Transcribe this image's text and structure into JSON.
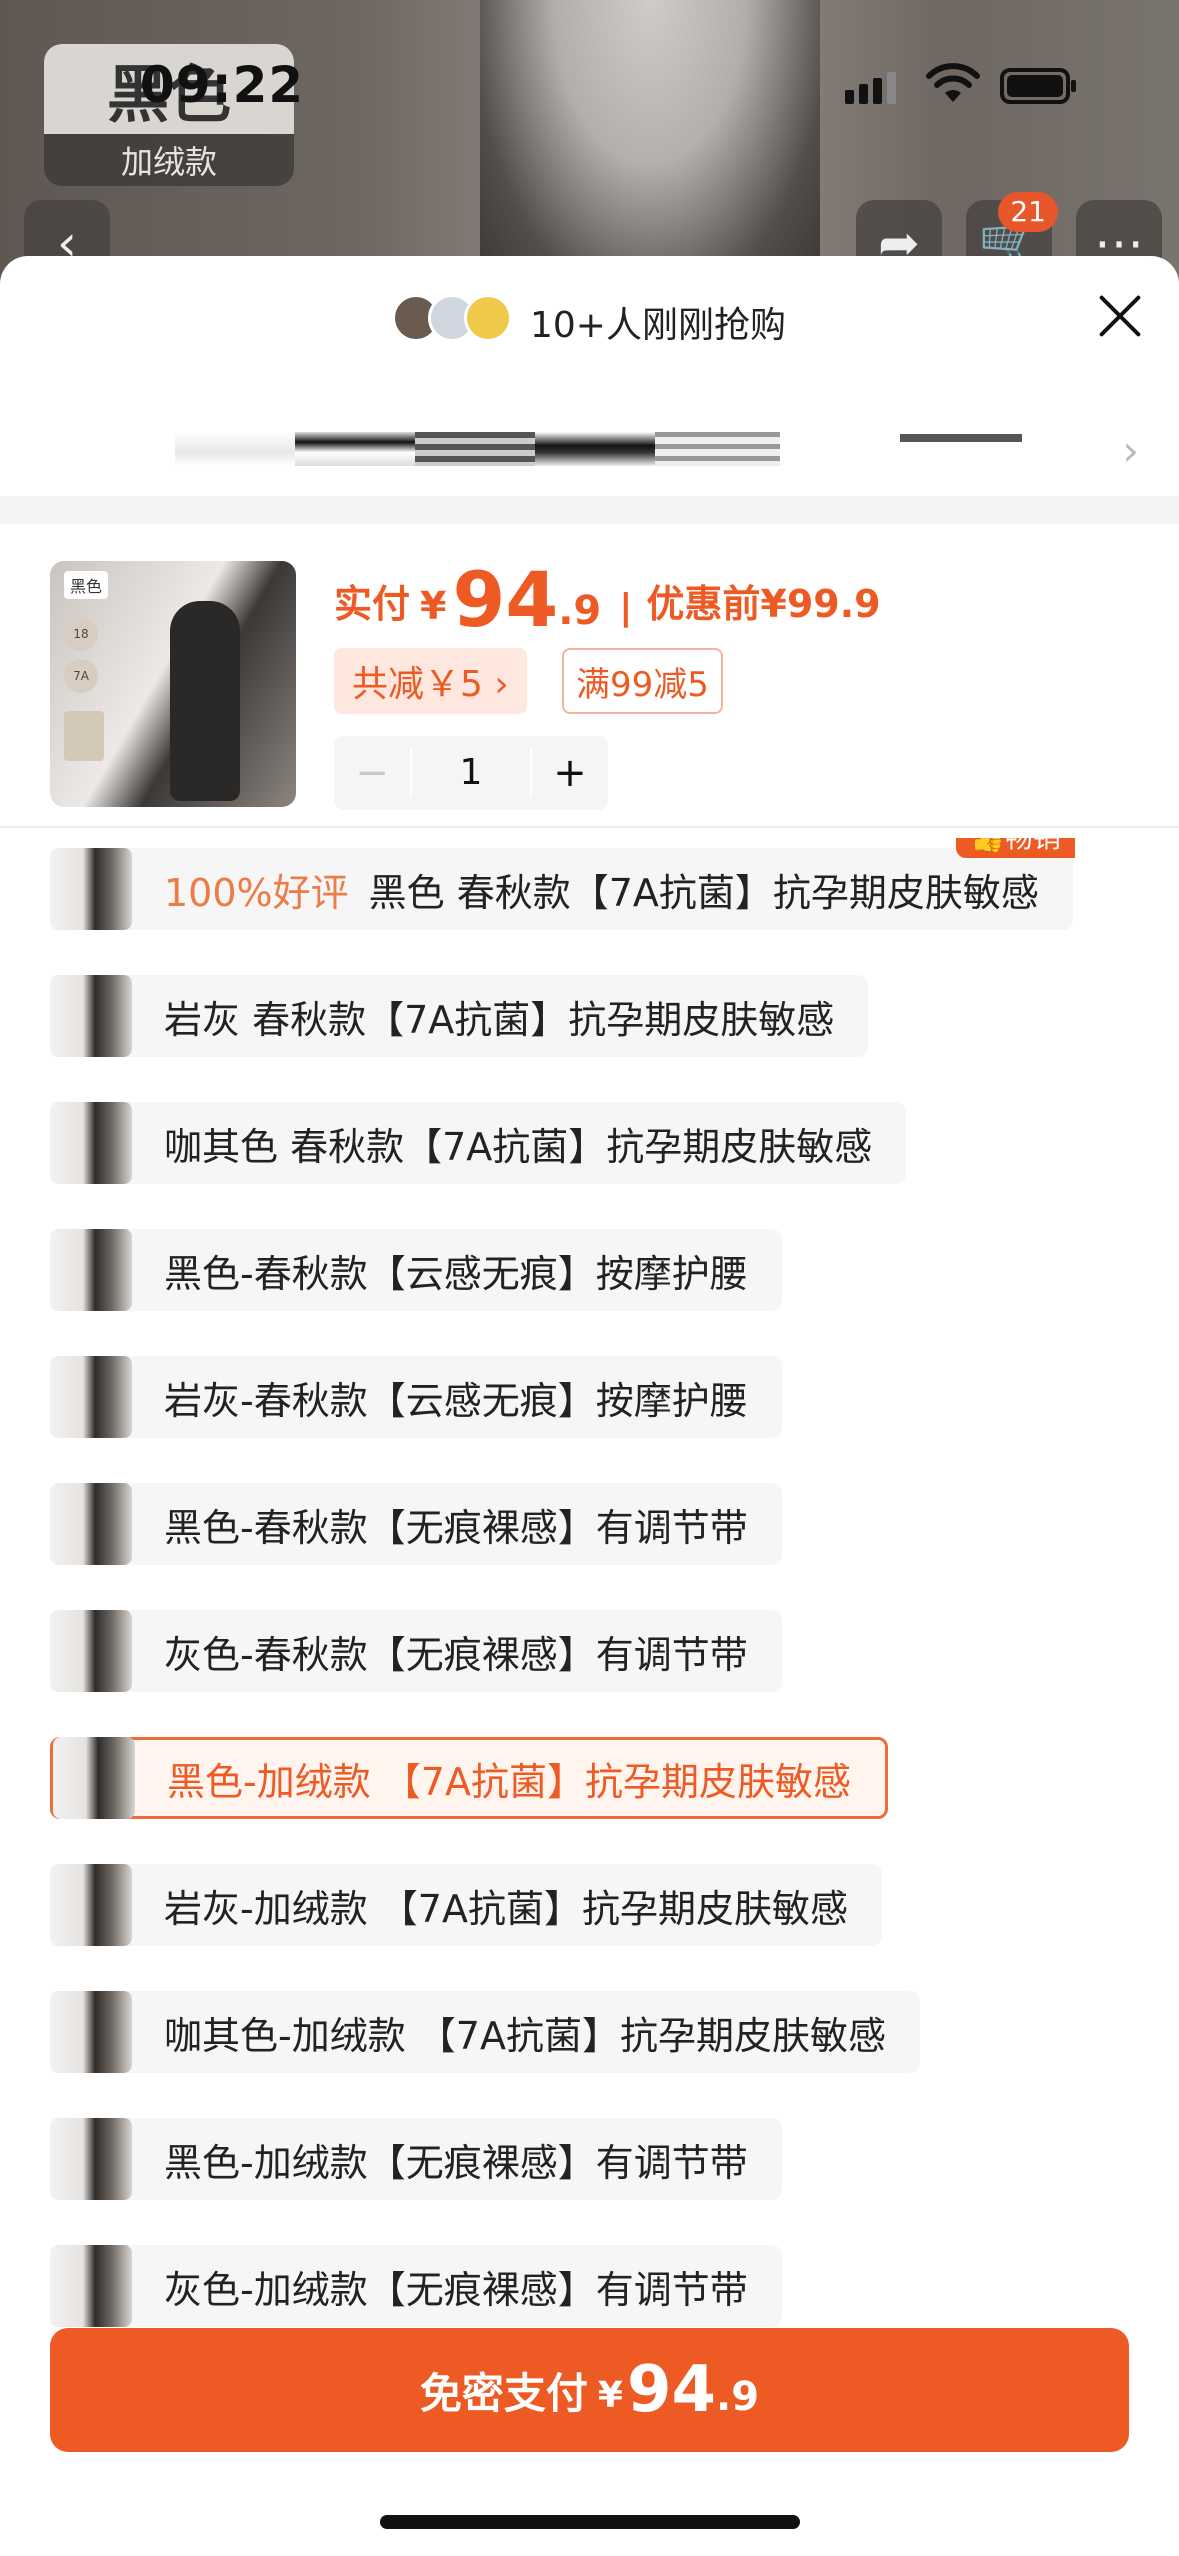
{
  "status_bar": {
    "time": "09:22"
  },
  "background": {
    "variant_tag_color": "黑色",
    "variant_tag_sub": "加绒款",
    "cart_count": "21"
  },
  "sheet": {
    "buyers_text": "10+人刚刚抢购",
    "product": {
      "image_label": "黑色",
      "price_prefix": "实付",
      "currency": "¥",
      "price_int": "94",
      "price_dec": ".9",
      "separator": "|",
      "original_price": "优惠前¥99.9",
      "discount": "共减￥5 ›",
      "coupon": "满99减5",
      "quantity": "1",
      "minus": "−",
      "plus": "+"
    },
    "options": [
      {
        "good_rating": "100%好评",
        "label": "黑色 春秋款【7A抗菌】抗孕期皮肤敏感",
        "badge": "畅销"
      },
      {
        "label": "岩灰 春秋款【7A抗菌】抗孕期皮肤敏感"
      },
      {
        "label": "咖其色 春秋款【7A抗菌】抗孕期皮肤敏感"
      },
      {
        "label": "黑色-春秋款【云感无痕】按摩护腰"
      },
      {
        "label": "岩灰-春秋款【云感无痕】按摩护腰"
      },
      {
        "label": "黑色-春秋款【无痕裸感】有调节带"
      },
      {
        "label": "灰色-春秋款【无痕裸感】有调节带"
      },
      {
        "label": "黑色-加绒款 【7A抗菌】抗孕期皮肤敏感",
        "selected": true
      },
      {
        "label": "岩灰-加绒款 【7A抗菌】抗孕期皮肤敏感"
      },
      {
        "label": "咖其色-加绒款 【7A抗菌】抗孕期皮肤敏感"
      },
      {
        "label": "黑色-加绒款【无痕裸感】有调节带"
      },
      {
        "label": "灰色-加绒款【无痕裸感】有调节带"
      }
    ],
    "pay": {
      "label": "免密支付",
      "currency": "¥",
      "int": "94",
      "dec": ".9"
    }
  },
  "colors": {
    "accent": "#ee5a24",
    "selected_bg": "#fff4ee"
  }
}
